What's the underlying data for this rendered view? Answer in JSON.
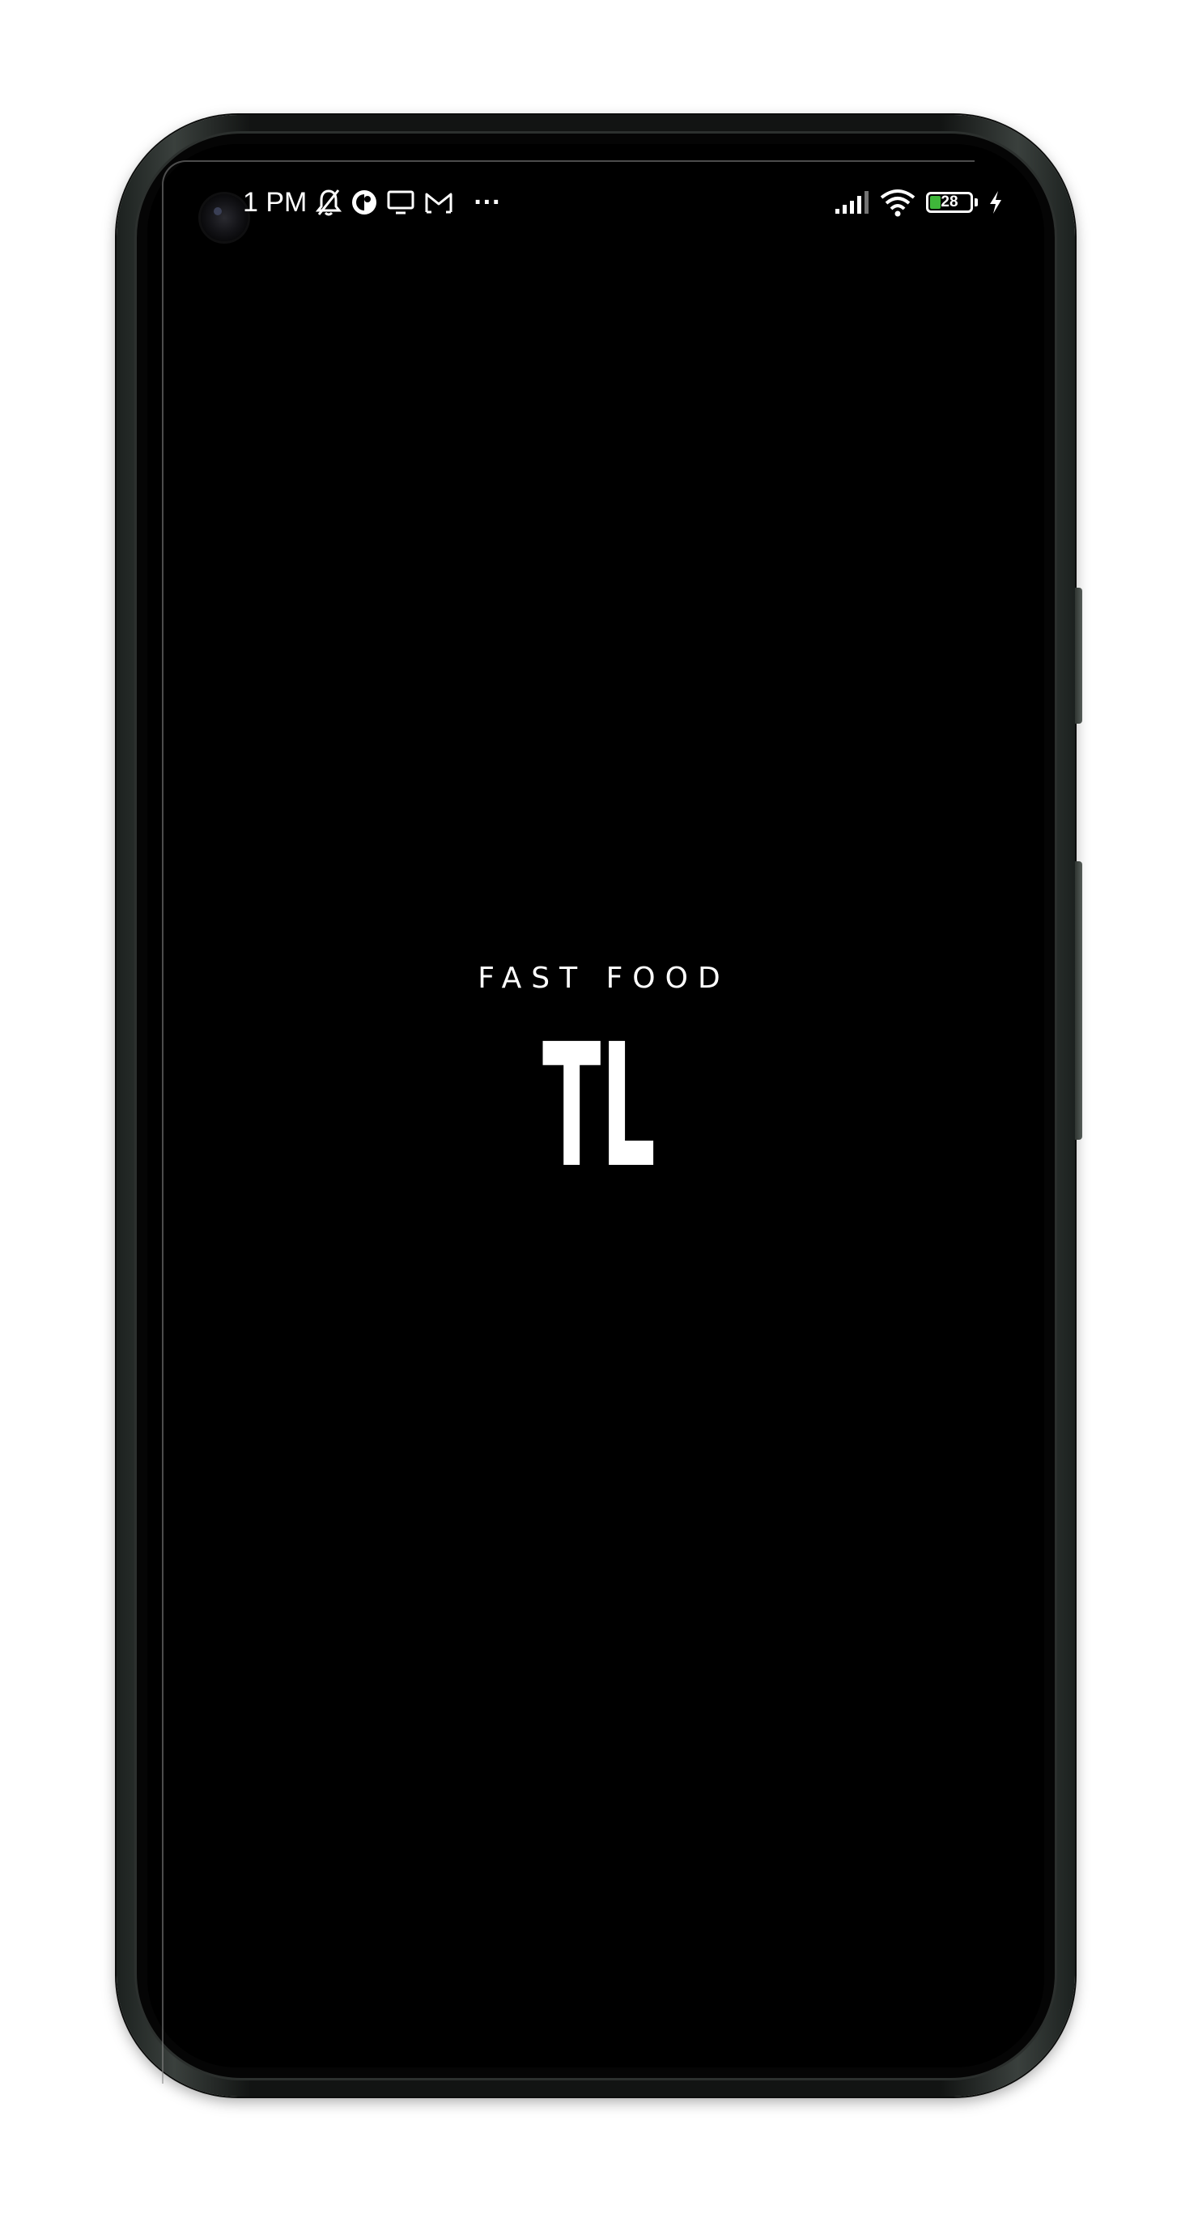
{
  "status_bar": {
    "time": "1 PM",
    "left_icons": [
      "bell-off-icon",
      "circle-app-icon",
      "monitor-icon",
      "gmail-icon",
      "more-dots-icon"
    ],
    "more_label": "···",
    "battery_level": "28",
    "battery_fraction": 0.28,
    "battery_color": "#3fb63a",
    "right_icons": [
      "cellular-signal-icon",
      "wifi-icon",
      "battery-icon",
      "charging-bolt-icon"
    ]
  },
  "splash": {
    "subtitle": "FAST FOOD",
    "logo_text": "TL"
  },
  "colors": {
    "screen_background": "#000000",
    "text": "#ffffff"
  }
}
